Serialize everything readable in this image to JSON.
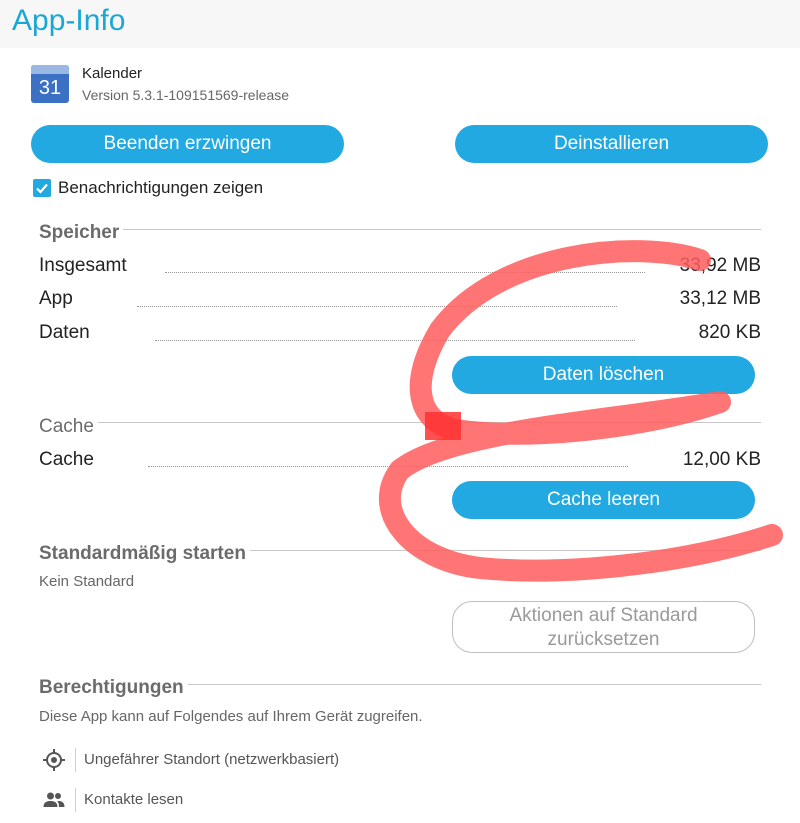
{
  "header": {
    "title": "App-Info"
  },
  "app": {
    "icon_day": "31",
    "name": "Kalender",
    "version": "Version 5.3.1-109151569-release"
  },
  "actions": {
    "force_stop": "Beenden erzwingen",
    "uninstall": "Deinstallieren"
  },
  "notifications": {
    "label": "Benachrichtigungen zeigen",
    "checked": true
  },
  "storage": {
    "title": "Speicher",
    "rows": [
      {
        "label": "Insgesamt",
        "value": "33,92 MB"
      },
      {
        "label": "App",
        "value": "33,12 MB"
      },
      {
        "label": "Daten",
        "value": "820 KB"
      }
    ],
    "clear_data": "Daten löschen"
  },
  "cache": {
    "title": "Cache",
    "rows": [
      {
        "label": "Cache",
        "value": "12,00 KB"
      }
    ],
    "clear_cache": "Cache leeren"
  },
  "defaults": {
    "title": "Standardmäßig starten",
    "subtitle": "Kein Standard",
    "reset_line1": "Aktionen auf Standard",
    "reset_line2": "zurücksetzen"
  },
  "permissions": {
    "title": "Berechtigungen",
    "subtitle": "Diese App kann auf Folgendes auf Ihrem Gerät zugreifen.",
    "items": [
      {
        "icon": "location-icon",
        "label": "Ungefährer Standort (netzwerkbasiert)"
      },
      {
        "icon": "contacts-icon",
        "label": "Kontakte lesen"
      }
    ]
  },
  "colors": {
    "accent": "#22a9e1",
    "title": "#1aa7d6",
    "scribble": "#ff5c5c"
  }
}
